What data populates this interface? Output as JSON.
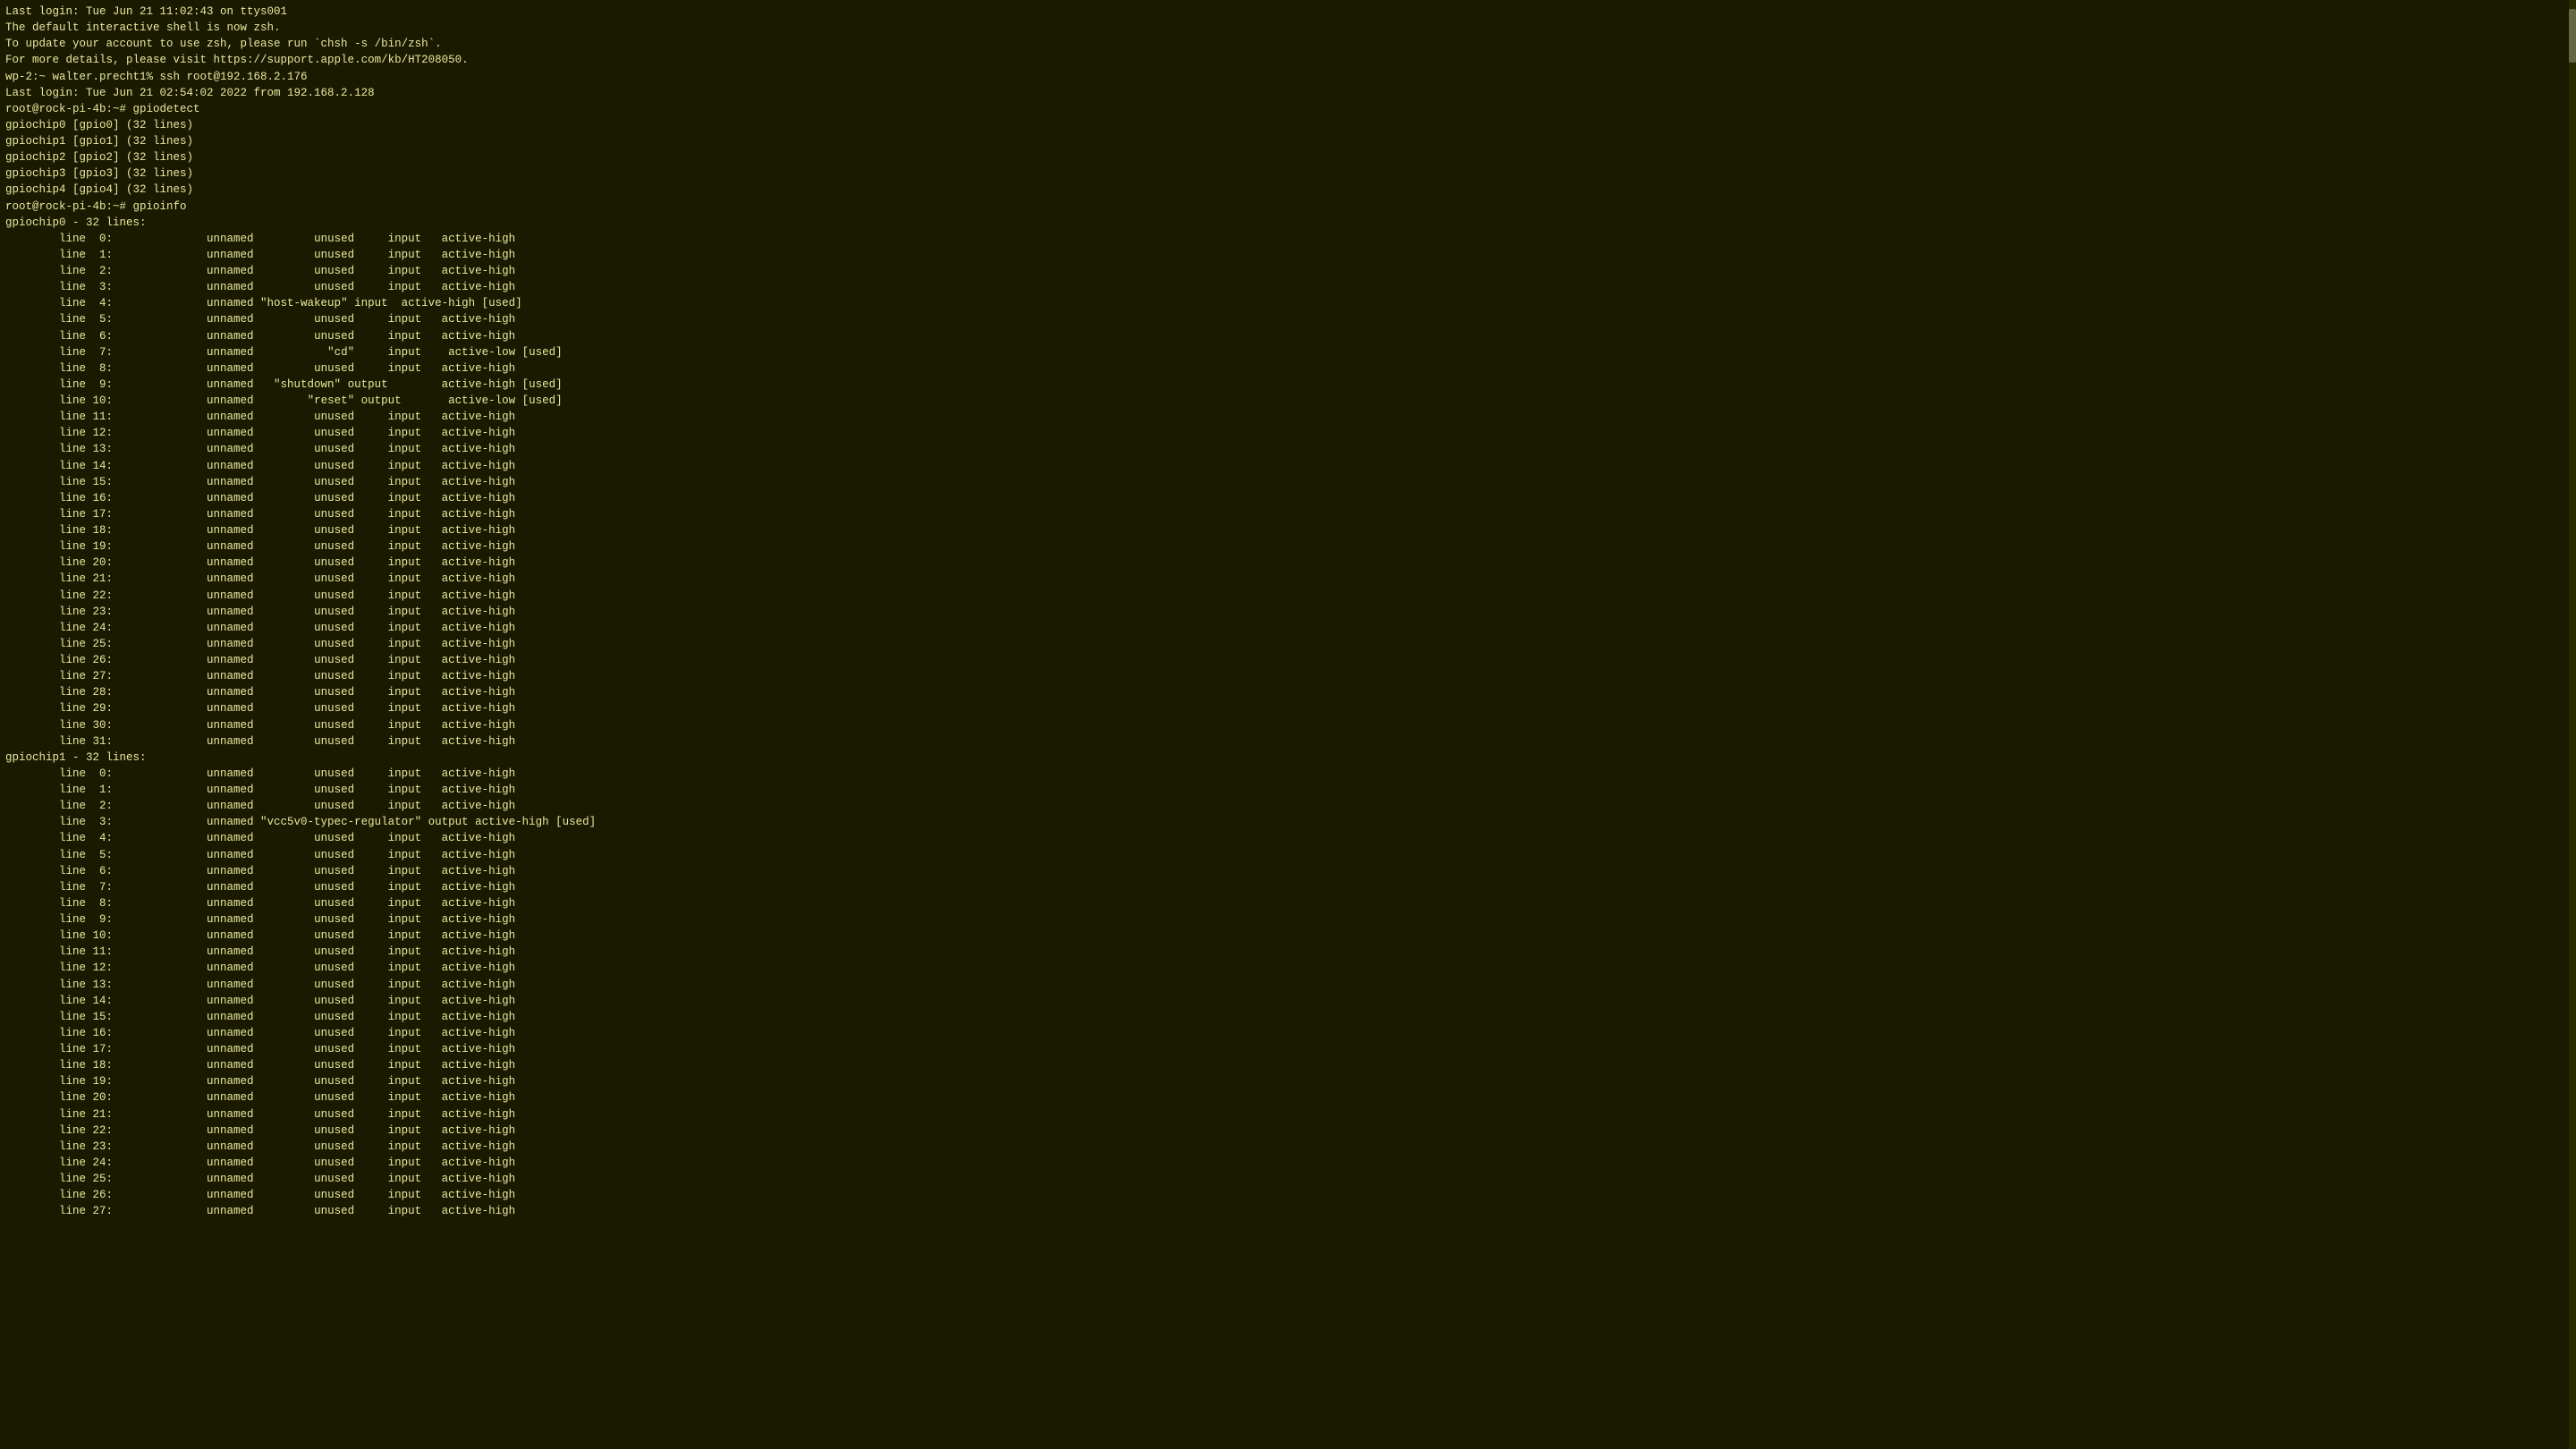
{
  "terminal": {
    "lines": [
      "Last login: Tue Jun 21 11:02:43 on ttys001",
      "",
      "The default interactive shell is now zsh.",
      "To update your account to use zsh, please run `chsh -s /bin/zsh`.",
      "For more details, please visit https://support.apple.com/kb/HT208050.",
      "wp-2:~ walter.precht1% ssh root@192.168.2.176",
      "Last login: Tue Jun 21 02:54:02 2022 from 192.168.2.128",
      "root@rock-pi-4b:~# gpiodetect",
      "gpiochip0 [gpio0] (32 lines)",
      "gpiochip1 [gpio1] (32 lines)",
      "gpiochip2 [gpio2] (32 lines)",
      "gpiochip3 [gpio3] (32 lines)",
      "gpiochip4 [gpio4] (32 lines)",
      "root@rock-pi-4b:~# gpioinfo",
      "gpiochip0 - 32 lines:",
      "\tline  0:\t      unnamed\t      unused\t input\t active-high",
      "\tline  1:\t      unnamed\t      unused\t input\t active-high",
      "\tline  2:\t      unnamed\t      unused\t input\t active-high",
      "\tline  3:\t      unnamed\t      unused\t input\t active-high",
      "\tline  4:\t      unnamed \"host-wakeup\" input  active-high [used]",
      "\tline  5:\t      unnamed\t      unused\t input\t active-high",
      "\tline  6:\t      unnamed\t      unused\t input\t active-high",
      "\tline  7:\t      unnamed\t        \"cd\"\t input\t  active-low [used]",
      "\tline  8:\t      unnamed\t      unused\t input\t active-high",
      "\tline  9:\t      unnamed   \"shutdown\" output\t active-high [used]",
      "\tline 10:\t      unnamed\t     \"reset\" output\t  active-low [used]",
      "\tline 11:\t      unnamed\t      unused\t input\t active-high",
      "\tline 12:\t      unnamed\t      unused\t input\t active-high",
      "\tline 13:\t      unnamed\t      unused\t input\t active-high",
      "\tline 14:\t      unnamed\t      unused\t input\t active-high",
      "\tline 15:\t      unnamed\t      unused\t input\t active-high",
      "\tline 16:\t      unnamed\t      unused\t input\t active-high",
      "\tline 17:\t      unnamed\t      unused\t input\t active-high",
      "\tline 18:\t      unnamed\t      unused\t input\t active-high",
      "\tline 19:\t      unnamed\t      unused\t input\t active-high",
      "\tline 20:\t      unnamed\t      unused\t input\t active-high",
      "\tline 21:\t      unnamed\t      unused\t input\t active-high",
      "\tline 22:\t      unnamed\t      unused\t input\t active-high",
      "\tline 23:\t      unnamed\t      unused\t input\t active-high",
      "\tline 24:\t      unnamed\t      unused\t input\t active-high",
      "\tline 25:\t      unnamed\t      unused\t input\t active-high",
      "\tline 26:\t      unnamed\t      unused\t input\t active-high",
      "\tline 27:\t      unnamed\t      unused\t input\t active-high",
      "\tline 28:\t      unnamed\t      unused\t input\t active-high",
      "\tline 29:\t      unnamed\t      unused\t input\t active-high",
      "\tline 30:\t      unnamed\t      unused\t input\t active-high",
      "\tline 31:\t      unnamed\t      unused\t input\t active-high",
      "gpiochip1 - 32 lines:",
      "\tline  0:\t      unnamed\t      unused\t input\t active-high",
      "\tline  1:\t      unnamed\t      unused\t input\t active-high",
      "\tline  2:\t      unnamed\t      unused\t input\t active-high",
      "\tline  3:\t      unnamed \"vcc5v0-typec-regulator\" output active-high [used]",
      "\tline  4:\t      unnamed\t      unused\t input\t active-high",
      "\tline  5:\t      unnamed\t      unused\t input\t active-high",
      "\tline  6:\t      unnamed\t      unused\t input\t active-high",
      "\tline  7:\t      unnamed\t      unused\t input\t active-high",
      "\tline  8:\t      unnamed\t      unused\t input\t active-high",
      "\tline  9:\t      unnamed\t      unused\t input\t active-high",
      "\tline 10:\t      unnamed\t      unused\t input\t active-high",
      "\tline 11:\t      unnamed\t      unused\t input\t active-high",
      "\tline 12:\t      unnamed\t      unused\t input\t active-high",
      "\tline 13:\t      unnamed\t      unused\t input\t active-high",
      "\tline 14:\t      unnamed\t      unused\t input\t active-high",
      "\tline 15:\t      unnamed\t      unused\t input\t active-high",
      "\tline 16:\t      unnamed\t      unused\t input\t active-high",
      "\tline 17:\t      unnamed\t      unused\t input\t active-high",
      "\tline 18:\t      unnamed\t      unused\t input\t active-high",
      "\tline 19:\t      unnamed\t      unused\t input\t active-high",
      "\tline 20:\t      unnamed\t      unused\t input\t active-high",
      "\tline 21:\t      unnamed\t      unused\t input\t active-high",
      "\tline 22:\t      unnamed\t      unused\t input\t active-high",
      "\tline 23:\t      unnamed\t      unused\t input\t active-high",
      "\tline 24:\t      unnamed\t      unused\t input\t active-high",
      "\tline 25:\t      unnamed\t      unused\t input\t active-high",
      "\tline 26:\t      unnamed\t      unused\t input\t active-high",
      "\tline 27:\t      unnamed\t      unused\t input\t active-high"
    ]
  }
}
